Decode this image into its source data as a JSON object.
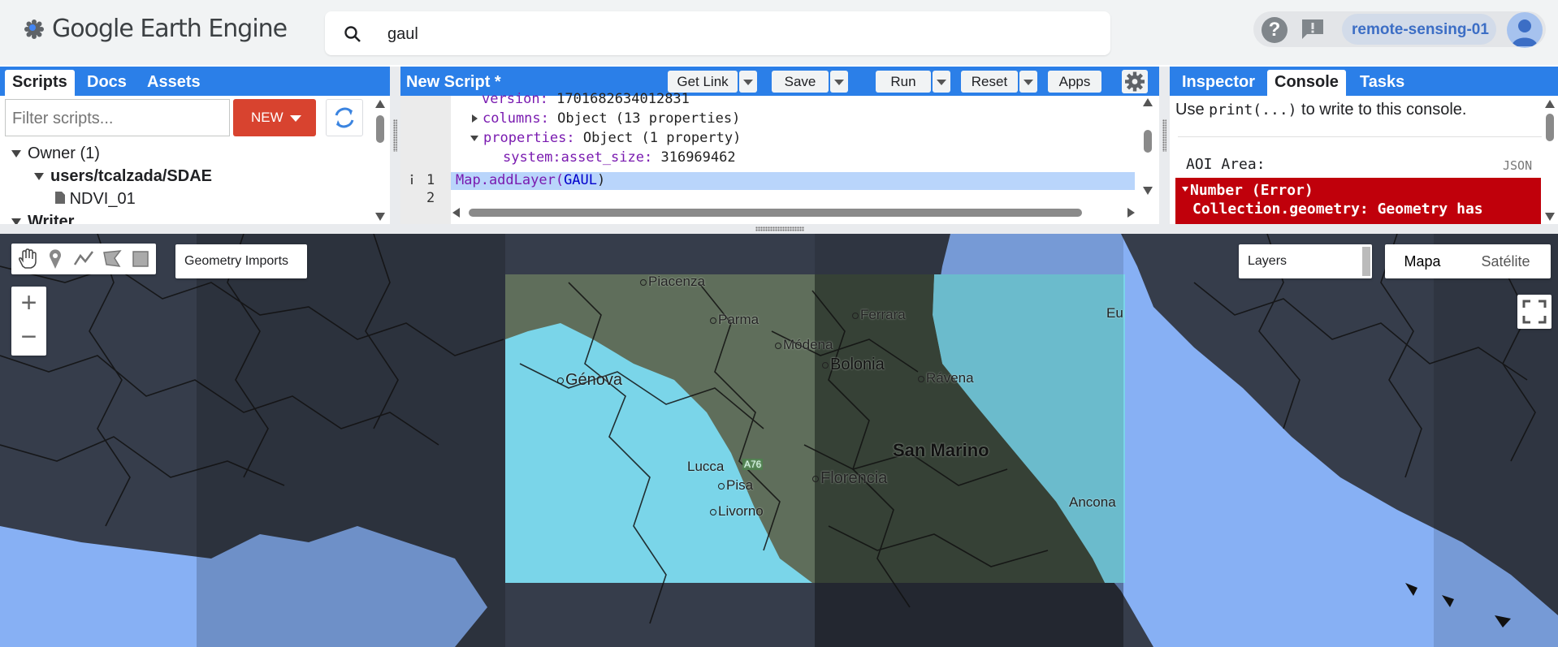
{
  "header": {
    "app_title": "Google Earth Engine",
    "search_value": "gaul",
    "account": "remote-sensing-01"
  },
  "left_panel": {
    "tabs": [
      "Scripts",
      "Docs",
      "Assets"
    ],
    "filter_placeholder": "Filter scripts...",
    "new_label": "NEW",
    "tree": [
      {
        "label": "Owner (1)"
      },
      {
        "label": "users/tcalzada/SDAE"
      },
      {
        "label": "NDVI_01"
      },
      {
        "label": "Writer"
      }
    ]
  },
  "editor": {
    "title": "New Script *",
    "buttons": {
      "get_link": "Get Link",
      "save": "Save",
      "run": "Run",
      "reset": "Reset",
      "apps": "Apps"
    },
    "lines": {
      "version_key": "version:",
      "version_val": "1701682634012831",
      "columns_key": "columns:",
      "columns_val": "Object (13 properties)",
      "properties_key": "properties:",
      "properties_val": "Object (1 property)",
      "asset_size_key": "system:asset_size:",
      "asset_size_val": "316969462",
      "line1_num": "1",
      "line2_num": "2",
      "line1_fn": "Map.addLayer(",
      "line1_arg": "GAUL",
      "line1_close": ")"
    }
  },
  "right_panel": {
    "tabs": [
      "Inspector",
      "Console",
      "Tasks"
    ],
    "hint_pre": "Use ",
    "hint_code": "print(...)",
    "hint_post": " to write to this console.",
    "aoi_label": "AOI Area:",
    "json_link": "JSON",
    "error_title": "Number (Error)",
    "error_msg": "Collection.geometry: Geometry has"
  },
  "map": {
    "geometry_imports": "Geometry Imports",
    "layers": "Layers",
    "map_types": [
      "Mapa",
      "Satélite"
    ],
    "zoom_in": "+",
    "zoom_out": "−",
    "cities": {
      "piacenza": "Piacenza",
      "parma": "Parma",
      "modena": "Módena",
      "ferrara": "Ferrara",
      "bolonia": "Bolonia",
      "ravena": "Rávena",
      "genova": "Génova",
      "san_marino": "San Marino",
      "lucca": "Lucca",
      "pisa": "Pisa",
      "livorno": "Livorno",
      "florencia": "Florencia",
      "ancona": "Ancona",
      "road": "A76",
      "partial": "Eu"
    }
  },
  "colors": {
    "accent_blue": "#2b7fe8",
    "new_red": "#d8432f",
    "error_red": "#c0000b",
    "sea": "#87b0f4",
    "cyan": "#7ad5e9"
  }
}
